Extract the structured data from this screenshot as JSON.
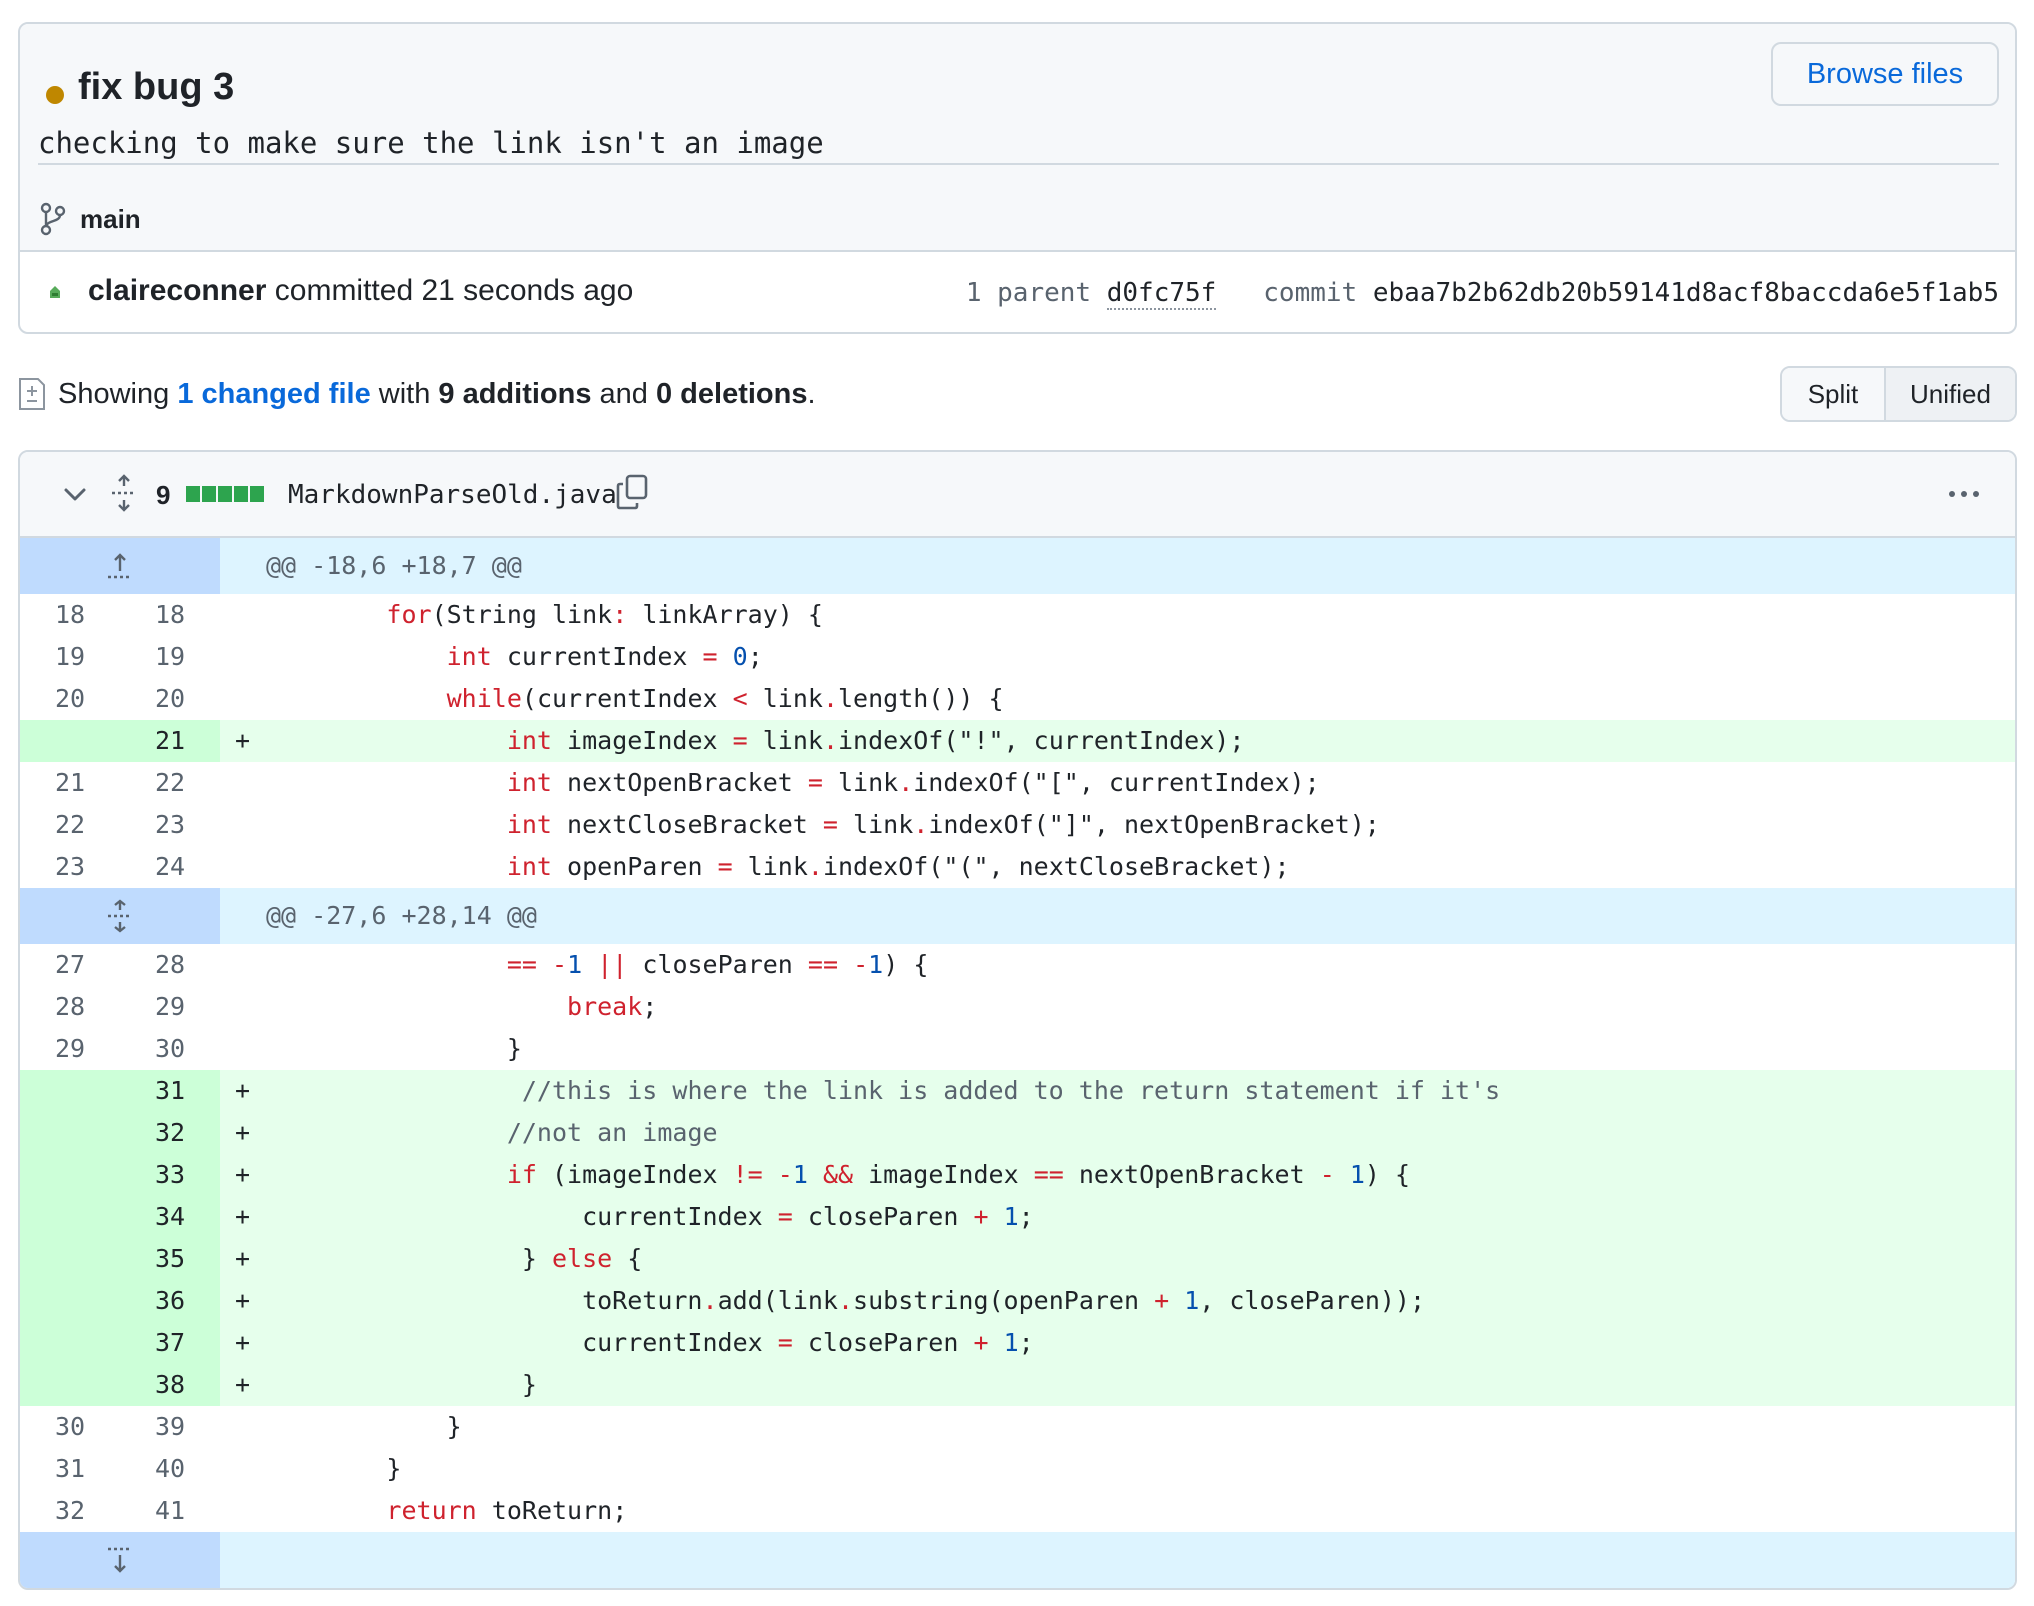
{
  "commit": {
    "title": "fix bug 3",
    "description": "checking to make sure the link isn't an image",
    "browse_files_label": "Browse files",
    "branch": "main",
    "author": "claireconner",
    "committed_text": "committed 21 seconds ago",
    "parent_label": "1 parent",
    "parent_hash": "d0fc75f",
    "commit_label": "commit",
    "commit_hash": "ebaa7b2b62db20b59141d8acf8baccda6e5f1ab5",
    "status_color": "#bf8700"
  },
  "summary": {
    "showing": "Showing",
    "changed_link": "1 changed file",
    "with": "with",
    "additions": "9 additions",
    "and": "and",
    "deletions": "0 deletions",
    "period": "."
  },
  "view_toggle": {
    "split_label": "Split",
    "unified_label": "Unified",
    "selected": "Unified"
  },
  "file": {
    "change_count": "9",
    "file_name": "MarkdownParseOld.java",
    "addition_blocks": 5,
    "addition_color": "#2da44e"
  },
  "hunks": [
    "@@ -18,6 +18,7 @@",
    "@@ -27,6 +28,14 @@"
  ],
  "lines": [
    {
      "old": "18",
      "new": "18",
      "sign": "",
      "type": "ctx",
      "code": "        for(String link: linkArray) {"
    },
    {
      "old": "19",
      "new": "19",
      "sign": "",
      "type": "ctx",
      "code": "            int currentIndex = 0;"
    },
    {
      "old": "20",
      "new": "20",
      "sign": "",
      "type": "ctx",
      "code": "            while(currentIndex < link.length()) {"
    },
    {
      "old": "",
      "new": "21",
      "sign": "+",
      "type": "add",
      "code": "                int imageIndex = link.indexOf(\"!\", currentIndex);"
    },
    {
      "old": "21",
      "new": "22",
      "sign": "",
      "type": "ctx",
      "code": "                int nextOpenBracket = link.indexOf(\"[\", currentIndex);"
    },
    {
      "old": "22",
      "new": "23",
      "sign": "",
      "type": "ctx",
      "code": "                int nextCloseBracket = link.indexOf(\"]\", nextOpenBracket);"
    },
    {
      "old": "23",
      "new": "24",
      "sign": "",
      "type": "ctx",
      "code": "                int openParen = link.indexOf(\"(\", nextCloseBracket);"
    },
    {
      "old": "27",
      "new": "28",
      "sign": "",
      "type": "ctx",
      "code": "                == -1 || closeParen == -1) {"
    },
    {
      "old": "28",
      "new": "29",
      "sign": "",
      "type": "ctx",
      "code": "                    break;"
    },
    {
      "old": "29",
      "new": "30",
      "sign": "",
      "type": "ctx",
      "code": "                }"
    },
    {
      "old": "",
      "new": "31",
      "sign": "+",
      "type": "add",
      "code": "                 //this is where the link is added to the return statement if it's"
    },
    {
      "old": "",
      "new": "32",
      "sign": "+",
      "type": "add",
      "code": "                //not an image"
    },
    {
      "old": "",
      "new": "33",
      "sign": "+",
      "type": "add",
      "code": "                if (imageIndex != -1 && imageIndex == nextOpenBracket - 1) {"
    },
    {
      "old": "",
      "new": "34",
      "sign": "+",
      "type": "add",
      "code": "                     currentIndex = closeParen + 1;"
    },
    {
      "old": "",
      "new": "35",
      "sign": "+",
      "type": "add",
      "code": "                 } else {"
    },
    {
      "old": "",
      "new": "36",
      "sign": "+",
      "type": "add",
      "code": "                     toReturn.add(link.substring(openParen + 1, closeParen));"
    },
    {
      "old": "",
      "new": "37",
      "sign": "+",
      "type": "add",
      "code": "                     currentIndex = closeParen + 1;"
    },
    {
      "old": "",
      "new": "38",
      "sign": "+",
      "type": "add",
      "code": "                 }"
    },
    {
      "old": "30",
      "new": "39",
      "sign": "",
      "type": "ctx",
      "code": "            }"
    },
    {
      "old": "31",
      "new": "40",
      "sign": "",
      "type": "ctx",
      "code": "        }"
    },
    {
      "old": "32",
      "new": "41",
      "sign": "",
      "type": "ctx",
      "code": "        return toReturn;"
    }
  ]
}
